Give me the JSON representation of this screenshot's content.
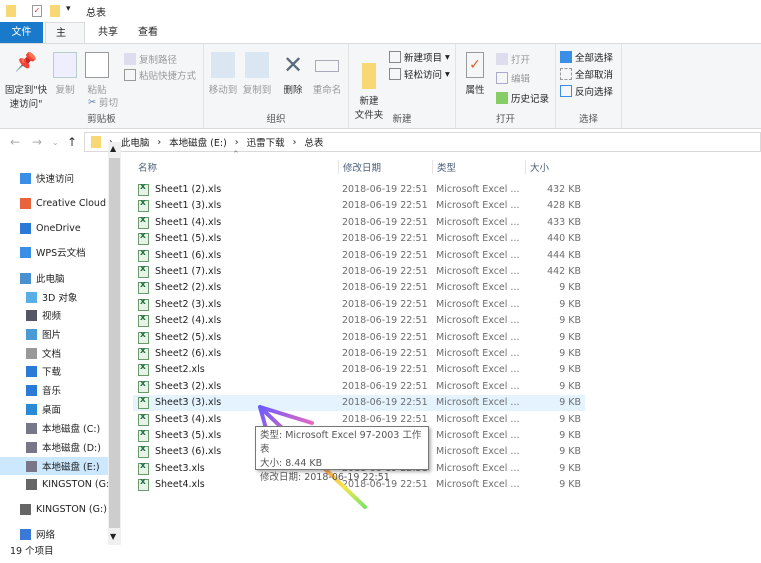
{
  "title": "总表",
  "tabs": {
    "file": "文件",
    "home": "主页",
    "share": "共享",
    "view": "查看"
  },
  "ribbon": {
    "clipboard": {
      "label": "剪贴板",
      "pin": "固定到\"快速访问\"",
      "copy": "复制",
      "paste": "粘贴",
      "copy_path": "复制路径",
      "paste_shortcut": "粘贴快捷方式",
      "cut": "剪切"
    },
    "organize": {
      "label": "组织",
      "move_to": "移动到",
      "copy_to": "复制到",
      "delete": "删除",
      "rename": "重命名"
    },
    "new": {
      "label": "新建",
      "new_folder": "新建\n文件夹",
      "new_item": "新建项目",
      "easy_access": "轻松访问"
    },
    "open": {
      "label": "打开",
      "properties": "属性",
      "open": "打开",
      "edit": "编辑",
      "history": "历史记录"
    },
    "select": {
      "label": "选择",
      "select_all": "全部选择",
      "select_none": "全部取消",
      "invert": "反向选择"
    }
  },
  "breadcrumb": [
    "此电脑",
    "本地磁盘 (E:)",
    "迅雷下载",
    "总表"
  ],
  "sidebar": [
    {
      "label": "快速访问",
      "icon": "star-icon"
    },
    {
      "label": "Creative Cloud Files",
      "icon": "creative-cloud-icon"
    },
    {
      "label": "OneDrive",
      "icon": "onedrive-icon"
    },
    {
      "label": "WPS云文档",
      "icon": "cloud-icon"
    },
    {
      "label": "此电脑",
      "icon": "computer-icon"
    },
    {
      "label": "3D 对象",
      "icon": "3d-objects-icon"
    },
    {
      "label": "视频",
      "icon": "video-icon"
    },
    {
      "label": "图片",
      "icon": "pictures-icon"
    },
    {
      "label": "文档",
      "icon": "documents-icon"
    },
    {
      "label": "下载",
      "icon": "download-icon"
    },
    {
      "label": "音乐",
      "icon": "music-icon"
    },
    {
      "label": "桌面",
      "icon": "desktop-icon"
    },
    {
      "label": "本地磁盘 (C:)",
      "icon": "drive-icon"
    },
    {
      "label": "本地磁盘 (D:)",
      "icon": "drive-icon"
    },
    {
      "label": "本地磁盘 (E:)",
      "icon": "drive-icon"
    },
    {
      "label": "KINGSTON (G:)",
      "icon": "usb-drive-icon"
    },
    {
      "label": "KINGSTON (G:)",
      "icon": "usb-drive-icon"
    },
    {
      "label": "网络",
      "icon": "network-icon"
    }
  ],
  "columns": {
    "name": "名称",
    "date": "修改日期",
    "type": "类型",
    "size": "大小"
  },
  "files": [
    {
      "name": "Sheet1 (2).xls",
      "date": "2018-06-19 22:51",
      "type": "Microsoft Excel ...",
      "size": "432 KB"
    },
    {
      "name": "Sheet1 (3).xls",
      "date": "2018-06-19 22:51",
      "type": "Microsoft Excel ...",
      "size": "428 KB"
    },
    {
      "name": "Sheet1 (4).xls",
      "date": "2018-06-19 22:51",
      "type": "Microsoft Excel ...",
      "size": "433 KB"
    },
    {
      "name": "Sheet1 (5).xls",
      "date": "2018-06-19 22:51",
      "type": "Microsoft Excel ...",
      "size": "440 KB"
    },
    {
      "name": "Sheet1 (6).xls",
      "date": "2018-06-19 22:51",
      "type": "Microsoft Excel ...",
      "size": "444 KB"
    },
    {
      "name": "Sheet1 (7).xls",
      "date": "2018-06-19 22:51",
      "type": "Microsoft Excel ...",
      "size": "442 KB"
    },
    {
      "name": "Sheet2 (2).xls",
      "date": "2018-06-19 22:51",
      "type": "Microsoft Excel ...",
      "size": "9 KB"
    },
    {
      "name": "Sheet2 (3).xls",
      "date": "2018-06-19 22:51",
      "type": "Microsoft Excel ...",
      "size": "9 KB"
    },
    {
      "name": "Sheet2 (4).xls",
      "date": "2018-06-19 22:51",
      "type": "Microsoft Excel ...",
      "size": "9 KB"
    },
    {
      "name": "Sheet2 (5).xls",
      "date": "2018-06-19 22:51",
      "type": "Microsoft Excel ...",
      "size": "9 KB"
    },
    {
      "name": "Sheet2 (6).xls",
      "date": "2018-06-19 22:51",
      "type": "Microsoft Excel ...",
      "size": "9 KB"
    },
    {
      "name": "Sheet2.xls",
      "date": "2018-06-19 22:51",
      "type": "Microsoft Excel ...",
      "size": "9 KB"
    },
    {
      "name": "Sheet3 (2).xls",
      "date": "2018-06-19 22:51",
      "type": "Microsoft Excel ...",
      "size": "9 KB"
    },
    {
      "name": "Sheet3 (3).xls",
      "date": "2018-06-19 22:51",
      "type": "Microsoft Excel ...",
      "size": "9 KB"
    },
    {
      "name": "Sheet3 (4).xls",
      "date": "2018-06-19 22:51",
      "type": "Microsoft Excel ...",
      "size": "9 KB"
    },
    {
      "name": "Sheet3 (5).xls",
      "date": "2018-06-19 22:51",
      "type": "Microsoft Excel ...",
      "size": "9 KB"
    },
    {
      "name": "Sheet3 (6).xls",
      "date": "2018-06-19 22:51",
      "type": "Microsoft Excel ...",
      "size": "9 KB"
    },
    {
      "name": "Sheet3.xls",
      "date": "2018-06-19 22:51",
      "type": "Microsoft Excel ...",
      "size": "9 KB"
    },
    {
      "name": "Sheet4.xls",
      "date": "2018-06-19 22:51",
      "type": "Microsoft Excel ...",
      "size": "9 KB"
    }
  ],
  "tooltip": {
    "type": "类型: Microsoft Excel 97-2003 工作表",
    "size": "大小: 8.44 KB",
    "date": "修改日期: 2018-06-19 22:51"
  },
  "status": "19 个项目"
}
